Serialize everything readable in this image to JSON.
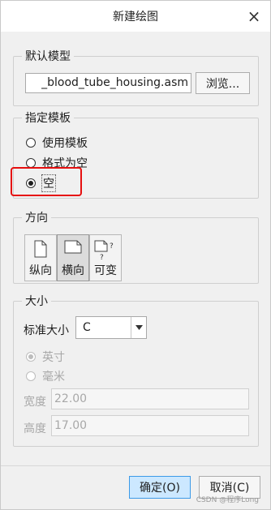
{
  "window": {
    "title": "新建绘图",
    "close_glyph": "×"
  },
  "default_model": {
    "group_title": "默认模型",
    "file_value": "_blood_tube_housing.asm",
    "browse_label": "浏览..."
  },
  "template": {
    "group_title": "指定模板",
    "options": [
      {
        "label": "使用模板",
        "checked": false
      },
      {
        "label": "格式为空",
        "checked": false
      },
      {
        "label": "空",
        "checked": true
      }
    ]
  },
  "orientation": {
    "group_title": "方向",
    "buttons": [
      {
        "label": "纵向",
        "icon": "portrait-page-icon",
        "selected": false
      },
      {
        "label": "横向",
        "icon": "landscape-page-icon",
        "selected": true
      },
      {
        "label": "可变",
        "icon": "variable-page-icon",
        "selected": false
      }
    ]
  },
  "size": {
    "group_title": "大小",
    "standard_label": "标准大小",
    "standard_value": "C",
    "units": [
      {
        "label": "英寸",
        "checked": true,
        "disabled": true
      },
      {
        "label": "毫米",
        "checked": false,
        "disabled": true
      }
    ],
    "width_label": "宽度",
    "width_value": "22.00",
    "height_label": "高度",
    "height_value": "17.00"
  },
  "footer": {
    "ok_label": "确定(O)",
    "cancel_label": "取消(C)"
  },
  "watermark": "CSDN @程序Long",
  "colors": {
    "highlight_box": "#e60f0f",
    "ok_button_bg": "#cce8ff",
    "ok_button_border": "#3c9ae8"
  }
}
